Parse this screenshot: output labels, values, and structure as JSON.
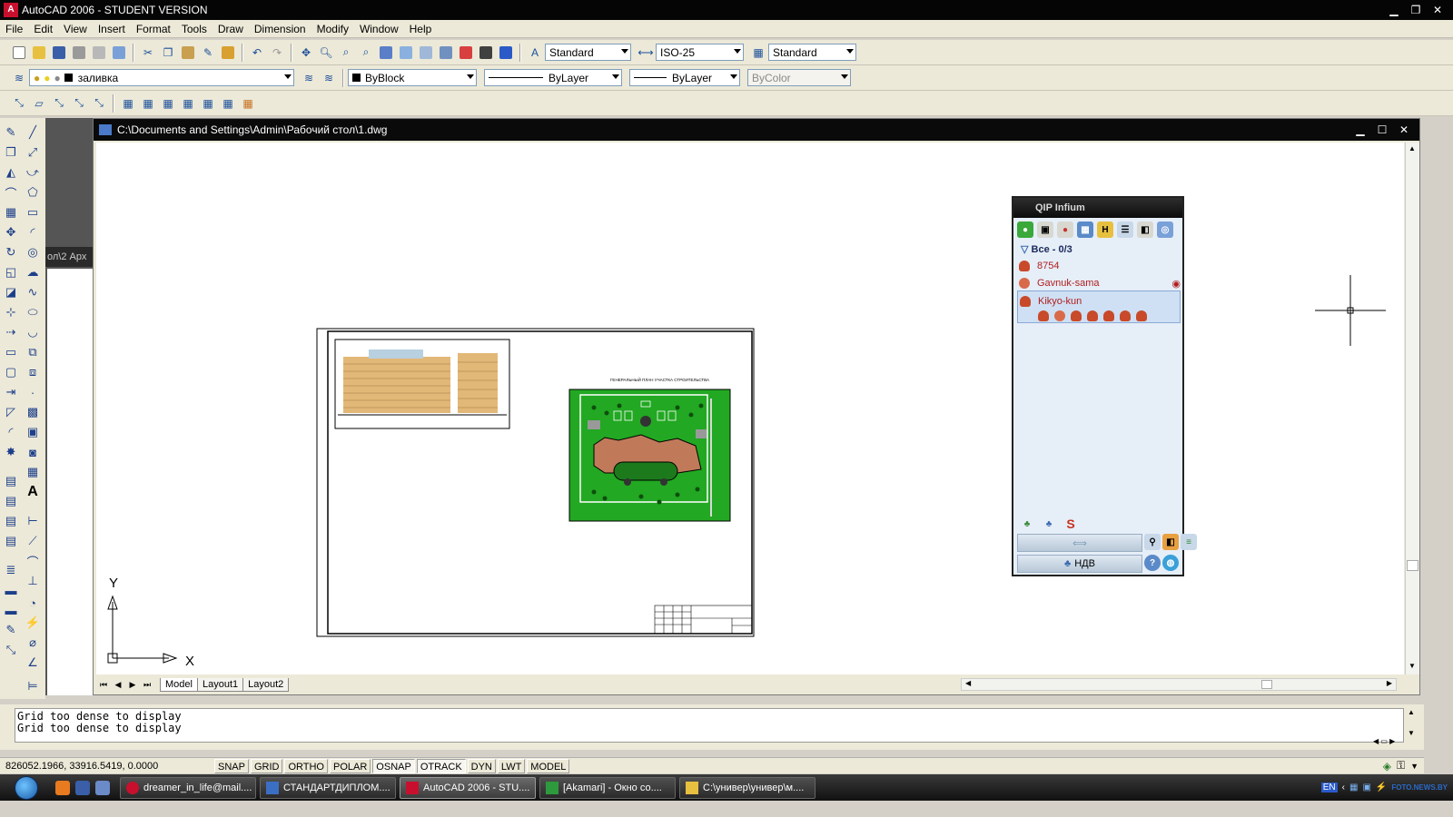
{
  "app": {
    "title": "AutoCAD 2006 - STUDENT VERSION",
    "logo": "A"
  },
  "menu": [
    "File",
    "Edit",
    "View",
    "Insert",
    "Format",
    "Tools",
    "Draw",
    "Dimension",
    "Modify",
    "Window",
    "Help"
  ],
  "styles_toolbar": {
    "text_style": "Standard",
    "dim_style": "ISO-25",
    "table_style": "Standard"
  },
  "layers_toolbar": {
    "layer": "заливка",
    "color": "ByBlock",
    "linetype": "ByLayer",
    "lineweight": "ByLayer",
    "plotstyle": "ByColor"
  },
  "partial_window_label": "ол\\2 Арх",
  "document": {
    "path": "C:\\Documents and Settings\\Admin\\Рабочий стол\\1.dwg",
    "tabs": [
      "Model",
      "Layout1",
      "Layout2"
    ],
    "active_tab": "Model",
    "ucs": {
      "x": "X",
      "y": "Y"
    },
    "siteplan_title": "ГЕНЕРАЛЬНЫЙ ПЛАН УЧАСТКА СТРОИТЕЛЬСТВА"
  },
  "command_lines": [
    "Grid too dense to display",
    "Grid too dense to display"
  ],
  "status": {
    "coords": "826052.1966, 33916.5419, 0.0000",
    "toggles": [
      {
        "label": "SNAP",
        "on": false
      },
      {
        "label": "GRID",
        "on": false
      },
      {
        "label": "ORTHO",
        "on": false
      },
      {
        "label": "POLAR",
        "on": false
      },
      {
        "label": "OSNAP",
        "on": true
      },
      {
        "label": "OTRACK",
        "on": true
      },
      {
        "label": "DYN",
        "on": false
      },
      {
        "label": "LWT",
        "on": false
      },
      {
        "label": "MODEL",
        "on": false
      }
    ]
  },
  "qip": {
    "title": "QIP Infium",
    "group": "Все - 0/3",
    "contacts": [
      "8754",
      "Gavnuk-sama",
      "Kikyo-kun"
    ],
    "status": "НДВ"
  },
  "taskbar": {
    "tasks": [
      {
        "label": "dreamer_in_life@mail....",
        "color": "#c8102e"
      },
      {
        "label": "СТАНДАРТДИПЛОМ....",
        "color": "#3b6fc4"
      },
      {
        "label": "AutoCAD 2006 - STU....",
        "color": "#c8102e",
        "active": true
      },
      {
        "label": "[Akamari] - Окно со....",
        "color": "#2e9a3e"
      },
      {
        "label": "C:\\универ\\универ\\м....",
        "color": "#e8c040"
      }
    ],
    "tray_lang": "EN",
    "watermark": "FOTO.NEWS.BY"
  },
  "colors": {
    "accent": "#0a246a",
    "grass": "#22a822",
    "building": "#c07a5a"
  }
}
